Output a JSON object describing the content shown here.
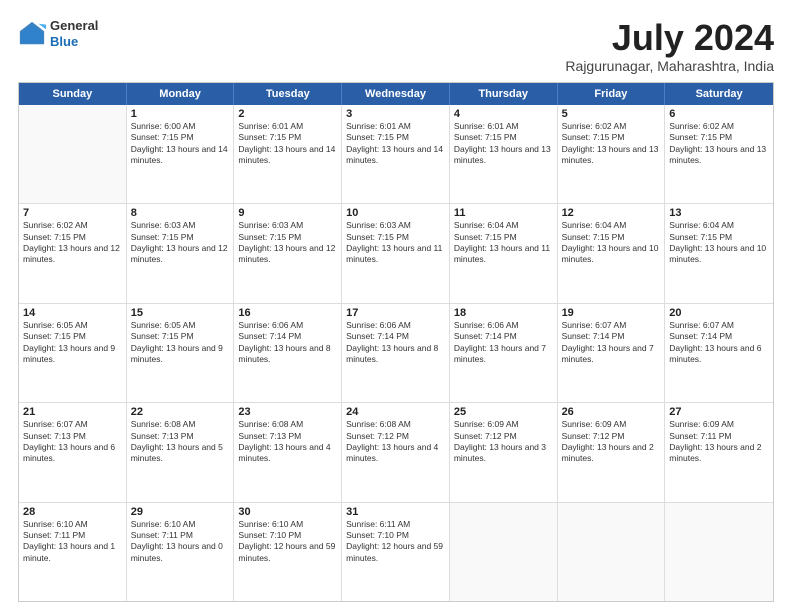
{
  "logo": {
    "general": "General",
    "blue": "Blue"
  },
  "title": {
    "month_year": "July 2024",
    "location": "Rajgurunagar, Maharashtra, India"
  },
  "header_days": [
    "Sunday",
    "Monday",
    "Tuesday",
    "Wednesday",
    "Thursday",
    "Friday",
    "Saturday"
  ],
  "rows": [
    [
      {
        "day": "",
        "sunrise": "",
        "sunset": "",
        "daylight": ""
      },
      {
        "day": "1",
        "sunrise": "Sunrise: 6:00 AM",
        "sunset": "Sunset: 7:15 PM",
        "daylight": "Daylight: 13 hours and 14 minutes."
      },
      {
        "day": "2",
        "sunrise": "Sunrise: 6:01 AM",
        "sunset": "Sunset: 7:15 PM",
        "daylight": "Daylight: 13 hours and 14 minutes."
      },
      {
        "day": "3",
        "sunrise": "Sunrise: 6:01 AM",
        "sunset": "Sunset: 7:15 PM",
        "daylight": "Daylight: 13 hours and 14 minutes."
      },
      {
        "day": "4",
        "sunrise": "Sunrise: 6:01 AM",
        "sunset": "Sunset: 7:15 PM",
        "daylight": "Daylight: 13 hours and 13 minutes."
      },
      {
        "day": "5",
        "sunrise": "Sunrise: 6:02 AM",
        "sunset": "Sunset: 7:15 PM",
        "daylight": "Daylight: 13 hours and 13 minutes."
      },
      {
        "day": "6",
        "sunrise": "Sunrise: 6:02 AM",
        "sunset": "Sunset: 7:15 PM",
        "daylight": "Daylight: 13 hours and 13 minutes."
      }
    ],
    [
      {
        "day": "7",
        "sunrise": "Sunrise: 6:02 AM",
        "sunset": "Sunset: 7:15 PM",
        "daylight": "Daylight: 13 hours and 12 minutes."
      },
      {
        "day": "8",
        "sunrise": "Sunrise: 6:03 AM",
        "sunset": "Sunset: 7:15 PM",
        "daylight": "Daylight: 13 hours and 12 minutes."
      },
      {
        "day": "9",
        "sunrise": "Sunrise: 6:03 AM",
        "sunset": "Sunset: 7:15 PM",
        "daylight": "Daylight: 13 hours and 12 minutes."
      },
      {
        "day": "10",
        "sunrise": "Sunrise: 6:03 AM",
        "sunset": "Sunset: 7:15 PM",
        "daylight": "Daylight: 13 hours and 11 minutes."
      },
      {
        "day": "11",
        "sunrise": "Sunrise: 6:04 AM",
        "sunset": "Sunset: 7:15 PM",
        "daylight": "Daylight: 13 hours and 11 minutes."
      },
      {
        "day": "12",
        "sunrise": "Sunrise: 6:04 AM",
        "sunset": "Sunset: 7:15 PM",
        "daylight": "Daylight: 13 hours and 10 minutes."
      },
      {
        "day": "13",
        "sunrise": "Sunrise: 6:04 AM",
        "sunset": "Sunset: 7:15 PM",
        "daylight": "Daylight: 13 hours and 10 minutes."
      }
    ],
    [
      {
        "day": "14",
        "sunrise": "Sunrise: 6:05 AM",
        "sunset": "Sunset: 7:15 PM",
        "daylight": "Daylight: 13 hours and 9 minutes."
      },
      {
        "day": "15",
        "sunrise": "Sunrise: 6:05 AM",
        "sunset": "Sunset: 7:15 PM",
        "daylight": "Daylight: 13 hours and 9 minutes."
      },
      {
        "day": "16",
        "sunrise": "Sunrise: 6:06 AM",
        "sunset": "Sunset: 7:14 PM",
        "daylight": "Daylight: 13 hours and 8 minutes."
      },
      {
        "day": "17",
        "sunrise": "Sunrise: 6:06 AM",
        "sunset": "Sunset: 7:14 PM",
        "daylight": "Daylight: 13 hours and 8 minutes."
      },
      {
        "day": "18",
        "sunrise": "Sunrise: 6:06 AM",
        "sunset": "Sunset: 7:14 PM",
        "daylight": "Daylight: 13 hours and 7 minutes."
      },
      {
        "day": "19",
        "sunrise": "Sunrise: 6:07 AM",
        "sunset": "Sunset: 7:14 PM",
        "daylight": "Daylight: 13 hours and 7 minutes."
      },
      {
        "day": "20",
        "sunrise": "Sunrise: 6:07 AM",
        "sunset": "Sunset: 7:14 PM",
        "daylight": "Daylight: 13 hours and 6 minutes."
      }
    ],
    [
      {
        "day": "21",
        "sunrise": "Sunrise: 6:07 AM",
        "sunset": "Sunset: 7:13 PM",
        "daylight": "Daylight: 13 hours and 6 minutes."
      },
      {
        "day": "22",
        "sunrise": "Sunrise: 6:08 AM",
        "sunset": "Sunset: 7:13 PM",
        "daylight": "Daylight: 13 hours and 5 minutes."
      },
      {
        "day": "23",
        "sunrise": "Sunrise: 6:08 AM",
        "sunset": "Sunset: 7:13 PM",
        "daylight": "Daylight: 13 hours and 4 minutes."
      },
      {
        "day": "24",
        "sunrise": "Sunrise: 6:08 AM",
        "sunset": "Sunset: 7:12 PM",
        "daylight": "Daylight: 13 hours and 4 minutes."
      },
      {
        "day": "25",
        "sunrise": "Sunrise: 6:09 AM",
        "sunset": "Sunset: 7:12 PM",
        "daylight": "Daylight: 13 hours and 3 minutes."
      },
      {
        "day": "26",
        "sunrise": "Sunrise: 6:09 AM",
        "sunset": "Sunset: 7:12 PM",
        "daylight": "Daylight: 13 hours and 2 minutes."
      },
      {
        "day": "27",
        "sunrise": "Sunrise: 6:09 AM",
        "sunset": "Sunset: 7:11 PM",
        "daylight": "Daylight: 13 hours and 2 minutes."
      }
    ],
    [
      {
        "day": "28",
        "sunrise": "Sunrise: 6:10 AM",
        "sunset": "Sunset: 7:11 PM",
        "daylight": "Daylight: 13 hours and 1 minute."
      },
      {
        "day": "29",
        "sunrise": "Sunrise: 6:10 AM",
        "sunset": "Sunset: 7:11 PM",
        "daylight": "Daylight: 13 hours and 0 minutes."
      },
      {
        "day": "30",
        "sunrise": "Sunrise: 6:10 AM",
        "sunset": "Sunset: 7:10 PM",
        "daylight": "Daylight: 12 hours and 59 minutes."
      },
      {
        "day": "31",
        "sunrise": "Sunrise: 6:11 AM",
        "sunset": "Sunset: 7:10 PM",
        "daylight": "Daylight: 12 hours and 59 minutes."
      },
      {
        "day": "",
        "sunrise": "",
        "sunset": "",
        "daylight": ""
      },
      {
        "day": "",
        "sunrise": "",
        "sunset": "",
        "daylight": ""
      },
      {
        "day": "",
        "sunrise": "",
        "sunset": "",
        "daylight": ""
      }
    ]
  ]
}
